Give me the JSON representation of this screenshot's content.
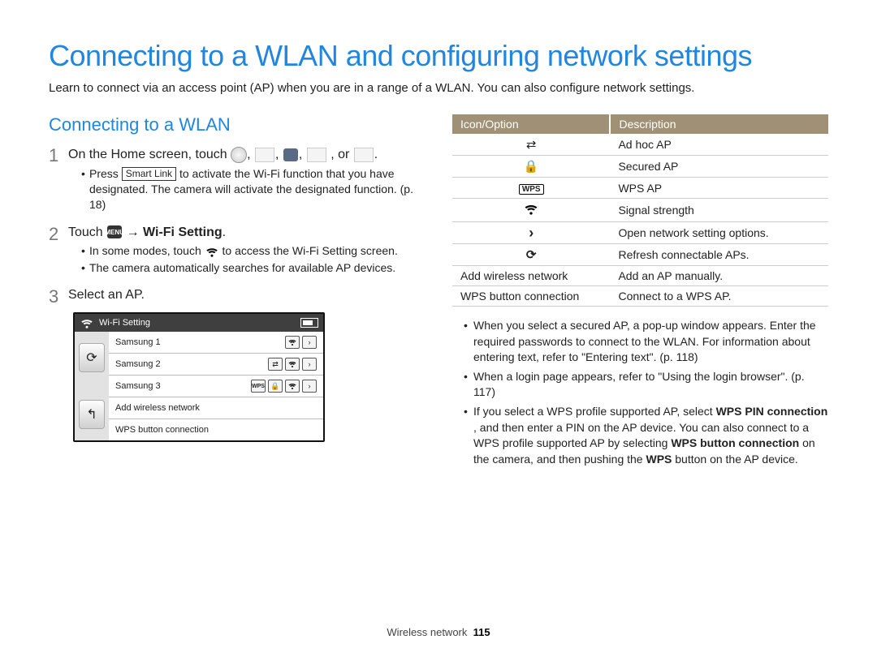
{
  "title": "Connecting to a WLAN and configuring network settings",
  "intro": "Learn to connect via an access point (AP) when you are in a range of a WLAN. You can also configure network settings.",
  "section_heading": "Connecting to a WLAN",
  "steps": {
    "s1": {
      "num": "1",
      "text_a": "On the Home screen, touch ",
      "text_b": ", or "
    },
    "s1_bullet": {
      "pre": "Press ",
      "chip": "Smart Link",
      "post": " to activate the Wi-Fi function that you have designated. The camera will activate the designated function. (p. 18)"
    },
    "s2": {
      "num": "2",
      "touch": "Touch ",
      "menu_label": "MENU",
      "arrow": "→ ",
      "bold": "Wi-Fi Setting",
      "end": "."
    },
    "s2_bullets": [
      {
        "pre": "In some modes, touch ",
        "post": " to access the Wi-Fi Setting screen."
      },
      {
        "text": "The camera automatically searches for available AP devices."
      }
    ],
    "s3": {
      "num": "3",
      "text": "Select an AP."
    }
  },
  "screen": {
    "title": "Wi-Fi Setting",
    "rows": [
      {
        "label": "Samsung 1",
        "icons": [
          "wifi",
          "chevron"
        ]
      },
      {
        "label": "Samsung 2",
        "icons": [
          "adhoc",
          "wifi",
          "chevron"
        ]
      },
      {
        "label": "Samsung 3",
        "icons": [
          "wps",
          "lock",
          "wifi",
          "chevron"
        ]
      },
      {
        "label": "Add wireless network",
        "icons": []
      },
      {
        "label": "WPS button connection",
        "icons": []
      }
    ]
  },
  "table": {
    "head": [
      "Icon/Option",
      "Description"
    ],
    "rows": [
      {
        "icon": "adhoc",
        "desc": "Ad hoc AP"
      },
      {
        "icon": "lock",
        "desc": "Secured AP"
      },
      {
        "icon": "wps",
        "desc": "WPS AP"
      },
      {
        "icon": "wifi",
        "desc": "Signal strength"
      },
      {
        "icon": "chevron",
        "desc": "Open network setting options."
      },
      {
        "icon": "refresh",
        "desc": "Refresh connectable APs."
      },
      {
        "label": "Add wireless network",
        "desc": "Add an AP manually."
      },
      {
        "label": "WPS button connection",
        "desc": "Connect to a WPS AP."
      }
    ]
  },
  "right_bullets": {
    "b1": "When you select a secured AP, a pop-up window appears. Enter the required passwords to connect to the WLAN. For information about entering text, refer to \"Entering text\". (p. 118)",
    "b2": "When a login page appears, refer to \"Using the login browser\". (p. 117)",
    "b3": {
      "p1": "If you select a WPS profile supported AP, select ",
      "bold1": "WPS PIN connection",
      "p2": ", and then enter a PIN on the AP device. You can also connect to a WPS profile supported AP by selecting ",
      "bold2": "WPS button connection",
      "p3": " on the camera, and then pushing the ",
      "bold3": "WPS",
      "p4": " button on the AP device."
    }
  },
  "footer": {
    "section": "Wireless network",
    "page": "115"
  },
  "icons": {
    "adhoc_glyph": "⇄",
    "lock_glyph": "🔒",
    "wps_glyph": "WPS",
    "chevron_glyph": "›",
    "refresh_glyph": "⟳",
    "back_glyph": "↰"
  }
}
